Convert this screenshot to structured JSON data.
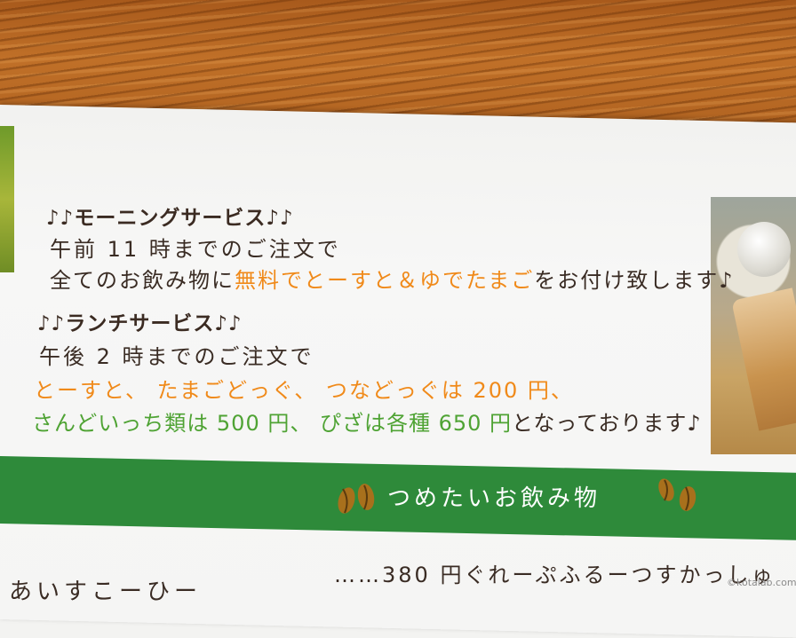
{
  "morning": {
    "heading": "♪♪モーニングサービス♪♪",
    "line1": "午前 11 時までのご注文で",
    "line2_prefix": "全てのお飲み物に",
    "line2_highlight": "無料でとーすと＆ゆでたまご",
    "line2_suffix": "をお付け致します♪"
  },
  "lunch": {
    "heading": "♪♪ランチサービス♪♪",
    "line1": "午後 2 時までのご注文で",
    "line2": "とーすと、 たまごどっぐ、 つなどっぐは 200 円、",
    "line3_highlight": "さんどいっち類は 500 円、 ぴざは各種 650 円",
    "line3_suffix": "となっております♪"
  },
  "banner": {
    "title": "つめたいお飲み物"
  },
  "menu": {
    "price_line": "……380 円ぐれーぷふるーつすかっしゅ",
    "item_partial": "あいすこーひー"
  },
  "watermark": "©kotalab.com",
  "colors": {
    "orange_text": "#f08a1a",
    "green_text": "#4fa334",
    "banner_green": "#2e8a3a",
    "bean_brown": "#a8701c"
  }
}
